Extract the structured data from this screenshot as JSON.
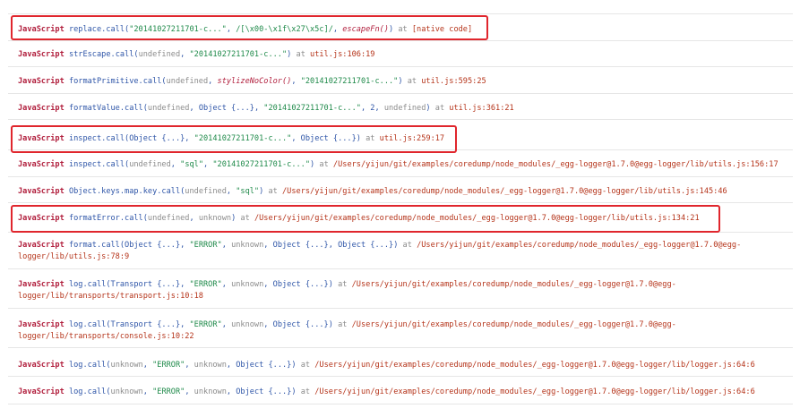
{
  "frames": [
    {
      "lang": "JavaScript",
      "fn": "replace",
      "call": ".call(",
      "args": [
        {
          "t": "str",
          "v": "\"20141027211701-c...\""
        },
        {
          "t": "p",
          "v": ", "
        },
        {
          "t": "str",
          "v": "/[\\x00-\\x1f\\x27\\x5c]/"
        },
        {
          "t": "p",
          "v": ", "
        },
        {
          "t": "italic",
          "v": "escapeFn()"
        },
        {
          "t": "p",
          "v": ")"
        }
      ],
      "at": " at ",
      "location": "[native code]",
      "wrap": ""
    },
    {
      "lang": "JavaScript",
      "fn": "strEscape",
      "call": ".call(",
      "args": [
        {
          "t": "dim",
          "v": "undefined"
        },
        {
          "t": "p",
          "v": ", "
        },
        {
          "t": "str",
          "v": "\"20141027211701-c...\""
        },
        {
          "t": "p",
          "v": ")"
        }
      ],
      "at": " at ",
      "location": "util.js:106:19",
      "wrap": ""
    },
    {
      "lang": "JavaScript",
      "fn": "formatPrimitive",
      "call": ".call(",
      "args": [
        {
          "t": "dim",
          "v": "undefined"
        },
        {
          "t": "p",
          "v": ", "
        },
        {
          "t": "italic",
          "v": "stylizeNoColor()"
        },
        {
          "t": "p",
          "v": ", "
        },
        {
          "t": "str",
          "v": "\"20141027211701-c...\""
        },
        {
          "t": "p",
          "v": ")"
        }
      ],
      "at": " at ",
      "location": "util.js:595:25",
      "wrap": ""
    },
    {
      "lang": "JavaScript",
      "fn": "formatValue",
      "call": ".call(",
      "args": [
        {
          "t": "dim",
          "v": "undefined"
        },
        {
          "t": "p",
          "v": ", "
        },
        {
          "t": "obj",
          "v": "Object {...}"
        },
        {
          "t": "p",
          "v": ", "
        },
        {
          "t": "str",
          "v": "\"20141027211701-c...\""
        },
        {
          "t": "p",
          "v": ", 2, "
        },
        {
          "t": "dim",
          "v": "undefined"
        },
        {
          "t": "p",
          "v": ")"
        }
      ],
      "at": " at ",
      "location": "util.js:361:21",
      "wrap": ""
    },
    {
      "lang": "JavaScript",
      "fn": "inspect",
      "call": ".call(",
      "args": [
        {
          "t": "obj",
          "v": "Object {...}"
        },
        {
          "t": "p",
          "v": ", "
        },
        {
          "t": "str",
          "v": "\"20141027211701-c...\""
        },
        {
          "t": "p",
          "v": ", "
        },
        {
          "t": "obj",
          "v": "Object {...}"
        },
        {
          "t": "p",
          "v": ")"
        }
      ],
      "at": " at ",
      "location": "util.js:259:17",
      "wrap": ""
    },
    {
      "lang": "JavaScript",
      "fn": "inspect",
      "call": ".call(",
      "args": [
        {
          "t": "dim",
          "v": "undefined"
        },
        {
          "t": "p",
          "v": ", "
        },
        {
          "t": "str",
          "v": "\"sql\""
        },
        {
          "t": "p",
          "v": ", "
        },
        {
          "t": "str",
          "v": "\"20141027211701-c...\""
        },
        {
          "t": "p",
          "v": ")"
        }
      ],
      "at": " at ",
      "location": "/Users/yijun/git/examples/coredump/node_modules/_egg-logger@1.7.0@egg-logger/lib/utils.js:156:17",
      "wrap": ""
    },
    {
      "lang": "JavaScript",
      "fn": "Object.keys.map.key",
      "call": ".call(",
      "args": [
        {
          "t": "dim",
          "v": "undefined"
        },
        {
          "t": "p",
          "v": ", "
        },
        {
          "t": "str",
          "v": "\"sql\""
        },
        {
          "t": "p",
          "v": ")"
        }
      ],
      "at": " at ",
      "location": "/Users/yijun/git/examples/coredump/node_modules/_egg-logger@1.7.0@egg-logger/lib/utils.js:145:46",
      "wrap": ""
    },
    {
      "lang": "JavaScript",
      "fn": "formatError",
      "call": ".call(",
      "args": [
        {
          "t": "dim",
          "v": "undefined"
        },
        {
          "t": "p",
          "v": ", "
        },
        {
          "t": "dim",
          "v": "unknown"
        },
        {
          "t": "p",
          "v": ")"
        }
      ],
      "at": " at ",
      "location": "/Users/yijun/git/examples/coredump/node_modules/_egg-logger@1.7.0@egg-logger/lib/utils.js:134:21",
      "wrap": ""
    },
    {
      "lang": "JavaScript",
      "fn": "format",
      "call": ".call(",
      "args": [
        {
          "t": "obj",
          "v": "Object {...}"
        },
        {
          "t": "p",
          "v": ", "
        },
        {
          "t": "str",
          "v": "\"ERROR\""
        },
        {
          "t": "p",
          "v": ", "
        },
        {
          "t": "dim",
          "v": "unknown"
        },
        {
          "t": "p",
          "v": ", "
        },
        {
          "t": "obj",
          "v": "Object {...}"
        },
        {
          "t": "p",
          "v": ", "
        },
        {
          "t": "obj",
          "v": "Object {...}"
        },
        {
          "t": "p",
          "v": ")"
        }
      ],
      "at": " at ",
      "location": "/Users/yijun/git/examples/coredump/node_modules/_egg-logger@1.7.0@egg-",
      "wrap": "logger/lib/utils.js:78:9"
    },
    {
      "lang": "JavaScript",
      "fn": "log",
      "call": ".call(",
      "args": [
        {
          "t": "obj",
          "v": "Transport {...}"
        },
        {
          "t": "p",
          "v": ", "
        },
        {
          "t": "str",
          "v": "\"ERROR\""
        },
        {
          "t": "p",
          "v": ", "
        },
        {
          "t": "dim",
          "v": "unknown"
        },
        {
          "t": "p",
          "v": ", "
        },
        {
          "t": "obj",
          "v": "Object {...}"
        },
        {
          "t": "p",
          "v": ")"
        }
      ],
      "at": " at ",
      "location": "/Users/yijun/git/examples/coredump/node_modules/_egg-logger@1.7.0@egg-",
      "wrap": "logger/lib/transports/transport.js:10:18"
    },
    {
      "lang": "JavaScript",
      "fn": "log",
      "call": ".call(",
      "args": [
        {
          "t": "obj",
          "v": "Transport {...}"
        },
        {
          "t": "p",
          "v": ", "
        },
        {
          "t": "str",
          "v": "\"ERROR\""
        },
        {
          "t": "p",
          "v": ", "
        },
        {
          "t": "dim",
          "v": "unknown"
        },
        {
          "t": "p",
          "v": ", "
        },
        {
          "t": "obj",
          "v": "Object {...}"
        },
        {
          "t": "p",
          "v": ")"
        }
      ],
      "at": " at ",
      "location": "/Users/yijun/git/examples/coredump/node_modules/_egg-logger@1.7.0@egg-",
      "wrap": "logger/lib/transports/console.js:10:22"
    },
    {
      "lang": "JavaScript",
      "fn": "log",
      "call": ".call(",
      "args": [
        {
          "t": "dim",
          "v": "unknown"
        },
        {
          "t": "p",
          "v": ", "
        },
        {
          "t": "str",
          "v": "\"ERROR\""
        },
        {
          "t": "p",
          "v": ", "
        },
        {
          "t": "dim",
          "v": "unknown"
        },
        {
          "t": "p",
          "v": ", "
        },
        {
          "t": "obj",
          "v": "Object {...}"
        },
        {
          "t": "p",
          "v": ")"
        }
      ],
      "at": " at ",
      "location": "/Users/yijun/git/examples/coredump/node_modules/_egg-logger@1.7.0@egg-logger/lib/logger.js:64:6",
      "wrap": ""
    },
    {
      "lang": "JavaScript",
      "fn": "log",
      "call": ".call(",
      "args": [
        {
          "t": "dim",
          "v": "unknown"
        },
        {
          "t": "p",
          "v": ", "
        },
        {
          "t": "str",
          "v": "\"ERROR\""
        },
        {
          "t": "p",
          "v": ", "
        },
        {
          "t": "dim",
          "v": "unknown"
        },
        {
          "t": "p",
          "v": ", "
        },
        {
          "t": "obj",
          "v": "Object {...}"
        },
        {
          "t": "p",
          "v": ")"
        }
      ],
      "at": " at ",
      "location": "/Users/yijun/git/examples/coredump/node_modules/_egg-logger@1.7.0@egg-logger/lib/logger.js:64:6",
      "wrap": ""
    }
  ],
  "highlighted_frames": [
    0,
    4,
    7
  ],
  "highlight_color": "#e0262d"
}
